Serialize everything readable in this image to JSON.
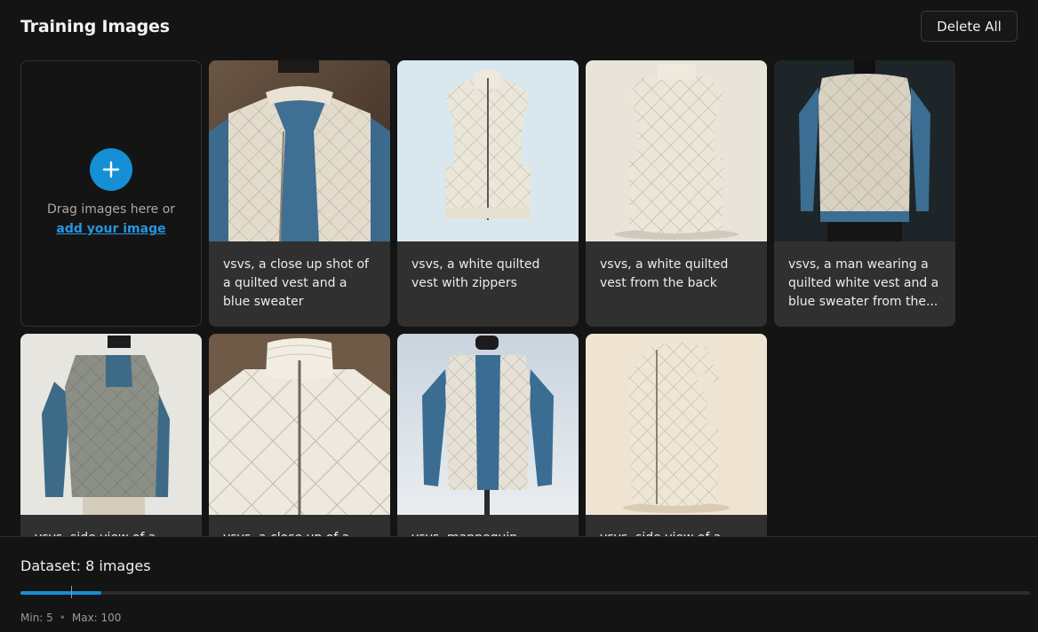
{
  "header": {
    "title": "Training Images",
    "delete_all_label": "Delete All"
  },
  "upload": {
    "icon": "plus-icon",
    "drag_text": "Drag images here or",
    "link_text": "add your image"
  },
  "images": [
    {
      "caption": "vsvs, a close up shot of a quilted vest and a blue sweater"
    },
    {
      "caption": "vsvs, a white quilted vest with zippers"
    },
    {
      "caption": "vsvs, a white quilted vest from the back"
    },
    {
      "caption": "vsvs, a man wearing a quilted white vest and a blue sweater from the..."
    },
    {
      "caption": "vsvs, side view of a..."
    },
    {
      "caption": "vsvs, a close up of a..."
    },
    {
      "caption": "vsvs, mannequin..."
    },
    {
      "caption": "vsvs, side view of a..."
    }
  ],
  "footer": {
    "dataset_label": "Dataset: 8 images",
    "progress_fraction": 0.08,
    "min_marker_fraction": 0.05,
    "min_label": "Min: 5",
    "max_label": "Max: 100"
  },
  "colors": {
    "accent": "#1590d6",
    "background": "#141414",
    "card": "#303030"
  }
}
